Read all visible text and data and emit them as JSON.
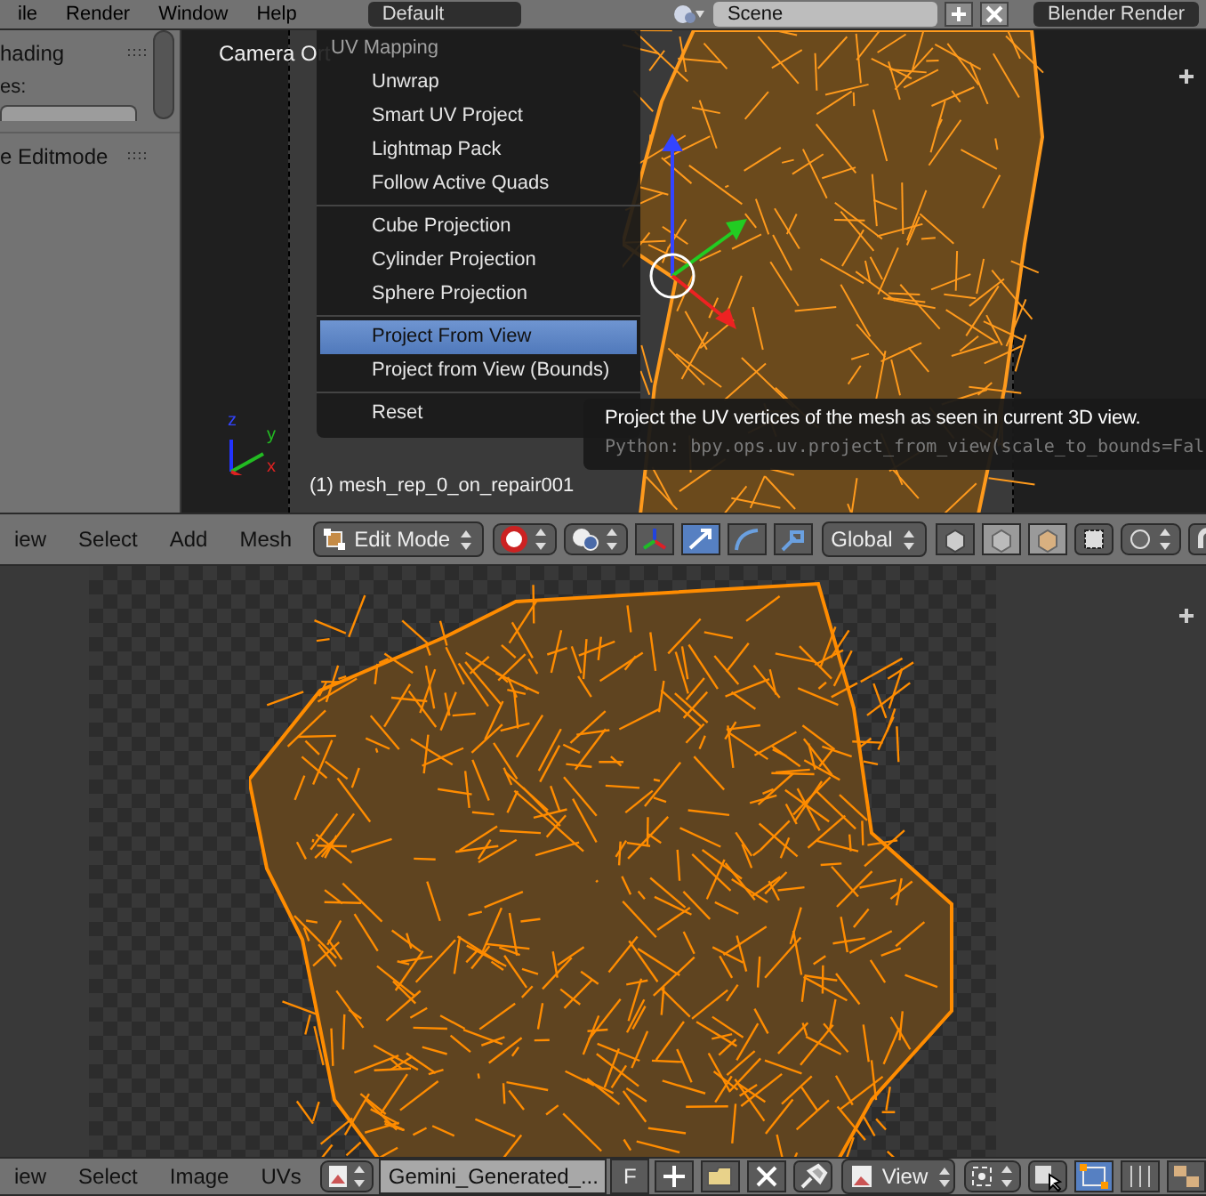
{
  "topbar": {
    "menus": [
      "ile",
      "Render",
      "Window",
      "Help"
    ],
    "screen": "Default",
    "scene": "Scene",
    "engine": "Blender Render"
  },
  "tool_panel": {
    "panel_title": "hading",
    "field_label": "es:",
    "panel_title_2": "e Editmode"
  },
  "viewport": {
    "view_name": "Camera Ort",
    "object_info": "(1) mesh_rep_0_on_repair001",
    "axes": [
      "z",
      "y",
      "x"
    ]
  },
  "menu": {
    "title": "UV Mapping",
    "groups": [
      [
        {
          "label": "Unwrap",
          "selected": false
        },
        {
          "label": "Smart UV Project",
          "selected": false
        },
        {
          "label": "Lightmap Pack",
          "selected": false
        },
        {
          "label": "Follow Active Quads",
          "selected": false
        }
      ],
      [
        {
          "label": "Cube Projection",
          "selected": false
        },
        {
          "label": "Cylinder Projection",
          "selected": false
        },
        {
          "label": "Sphere Projection",
          "selected": false
        }
      ],
      [
        {
          "label": "Project From View",
          "selected": true
        },
        {
          "label": "Project from View (Bounds)",
          "selected": false
        }
      ],
      [
        {
          "label": "Reset",
          "selected": false
        }
      ]
    ]
  },
  "tooltip": {
    "description": "Project the UV vertices of the mesh as seen in current 3D view.",
    "python": "Python: bpy.ops.uv.project_from_view(scale_to_bounds=Fal"
  },
  "view3d_header": {
    "menus": [
      "iew",
      "Select",
      "Add",
      "Mesh"
    ],
    "mode": "Edit Mode",
    "orientation": "Global"
  },
  "image_header": {
    "menus": [
      "iew",
      "Select",
      "Image",
      "UVs"
    ],
    "image_name": "Gemini_Generated_...",
    "fake_user": "F",
    "view_mode": "View"
  }
}
